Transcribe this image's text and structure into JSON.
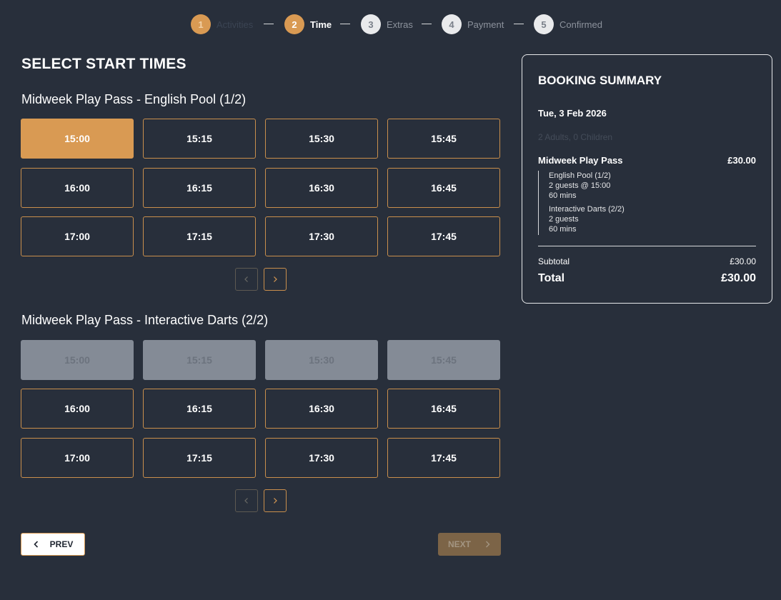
{
  "stepper": {
    "steps": [
      {
        "num": "1",
        "label": "Activities",
        "state": "done"
      },
      {
        "num": "2",
        "label": "Time",
        "state": "active"
      },
      {
        "num": "3",
        "label": "Extras",
        "state": "todo"
      },
      {
        "num": "4",
        "label": "Payment",
        "state": "todo"
      },
      {
        "num": "5",
        "label": "Confirmed",
        "state": "todo"
      }
    ]
  },
  "page_title": "SELECT START TIMES",
  "sections": [
    {
      "title": "Midweek Play Pass - English Pool (1/2)",
      "slots": [
        {
          "time": "15:00",
          "state": "selected"
        },
        {
          "time": "15:15",
          "state": "available"
        },
        {
          "time": "15:30",
          "state": "available"
        },
        {
          "time": "15:45",
          "state": "available"
        },
        {
          "time": "16:00",
          "state": "available"
        },
        {
          "time": "16:15",
          "state": "available"
        },
        {
          "time": "16:30",
          "state": "available"
        },
        {
          "time": "16:45",
          "state": "available"
        },
        {
          "time": "17:00",
          "state": "available"
        },
        {
          "time": "17:15",
          "state": "available"
        },
        {
          "time": "17:30",
          "state": "available"
        },
        {
          "time": "17:45",
          "state": "available"
        }
      ],
      "pager": {
        "prev_icon": "chevron-left-icon",
        "next_icon": "chevron-right-icon"
      }
    },
    {
      "title": "Midweek Play Pass - Interactive Darts (2/2)",
      "slots": [
        {
          "time": "15:00",
          "state": "disabled"
        },
        {
          "time": "15:15",
          "state": "disabled"
        },
        {
          "time": "15:30",
          "state": "disabled"
        },
        {
          "time": "15:45",
          "state": "disabled"
        },
        {
          "time": "16:00",
          "state": "available"
        },
        {
          "time": "16:15",
          "state": "available"
        },
        {
          "time": "16:30",
          "state": "available"
        },
        {
          "time": "16:45",
          "state": "available"
        },
        {
          "time": "17:00",
          "state": "available"
        },
        {
          "time": "17:15",
          "state": "available"
        },
        {
          "time": "17:30",
          "state": "available"
        },
        {
          "time": "17:45",
          "state": "available"
        }
      ],
      "pager": {
        "prev_icon": "chevron-left-icon",
        "next_icon": "chevron-right-icon"
      }
    }
  ],
  "nav": {
    "prev_label": "PREV",
    "next_label": "NEXT"
  },
  "summary": {
    "title": "BOOKING SUMMARY",
    "date": "Tue, 3 Feb 2026",
    "guests": "2 Adults, 0 Children",
    "item_name": "Midweek Play Pass",
    "item_price": "£30.00",
    "details": [
      {
        "name": "English Pool (1/2)",
        "guests": "2 guests @ 15:00",
        "duration": "60 mins"
      },
      {
        "name": "Interactive Darts (2/2)",
        "guests": "2 guests",
        "duration": "60 mins"
      }
    ],
    "subtotal_label": "Subtotal",
    "subtotal_value": "£30.00",
    "total_label": "Total",
    "total_value": "£30.00"
  },
  "colors": {
    "accent": "#d99a53",
    "background": "#282f3b",
    "disabled": "#848b96"
  }
}
